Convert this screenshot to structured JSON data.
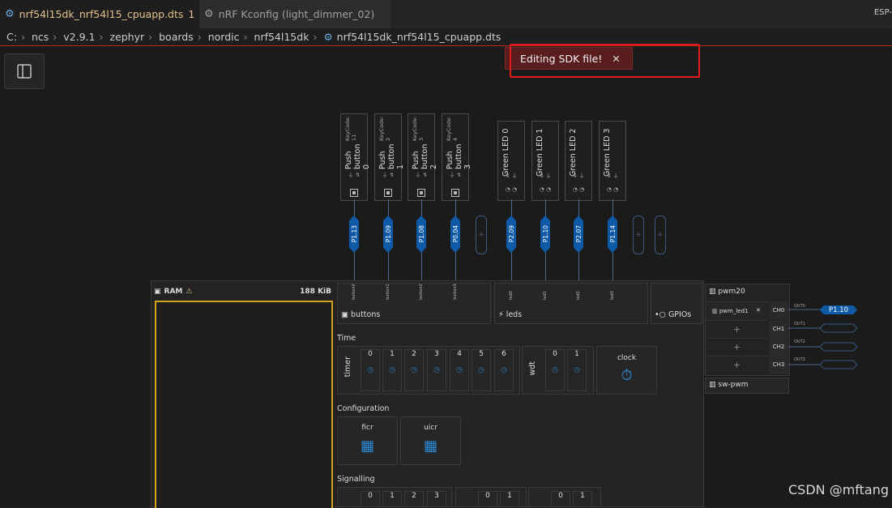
{
  "tabs": [
    {
      "label": "nrf54l15dk_nrf54l15_cpuapp.dts",
      "modified": "1",
      "icon": "devicetree-icon"
    },
    {
      "label": "nRF Kconfig (light_dimmer_02)",
      "icon": "gear-icon"
    }
  ],
  "top_right_label": "ESP-",
  "breadcrumbs": [
    "C:",
    "ncs",
    "v2.9.1",
    "zephyr",
    "boards",
    "nordic",
    "nrf54l15dk",
    "nrf54l15dk_nrf54l15_cpuapp.dts"
  ],
  "notification": {
    "text": "Editing SDK file!",
    "close": "✕"
  },
  "buttons": [
    {
      "name": "Push button 0",
      "keycode": "KeyCode: 11",
      "pin": "P1.13",
      "label": "button0"
    },
    {
      "name": "Push button 1",
      "keycode": "KeyCode: 2",
      "pin": "P1.09",
      "label": "button1"
    },
    {
      "name": "Push button 2",
      "keycode": "KeyCode: 3",
      "pin": "P1.08",
      "label": "button2"
    },
    {
      "name": "Push button 3",
      "keycode": "KeyCode: 4",
      "pin": "P0.04",
      "label": "button3"
    }
  ],
  "leds": [
    {
      "name": "Green LED 0",
      "pin": "P2.09",
      "label": "led0"
    },
    {
      "name": "Green LED 1",
      "pin": "P1.10",
      "label": "led1"
    },
    {
      "name": "Green LED 2",
      "pin": "P2.07",
      "label": "led2"
    },
    {
      "name": "Green LED 3",
      "pin": "P1.14",
      "label": "led3"
    }
  ],
  "ram": {
    "label": "RAM",
    "size": "188 KiB"
  },
  "groups": {
    "buttons": "buttons",
    "leds": "leds",
    "gpios": "GPIOs"
  },
  "time": {
    "section": "Time",
    "timer_label": "timer",
    "timers": [
      "0",
      "1",
      "2",
      "3",
      "4",
      "5",
      "6"
    ],
    "wdt_label": "wdt",
    "wdts": [
      "0",
      "1"
    ],
    "clock_label": "clock"
  },
  "configuration": {
    "section": "Configuration",
    "items": [
      "ficr",
      "uicr"
    ]
  },
  "signalling": {
    "section": "Signalling",
    "a": [
      "0",
      "1",
      "2",
      "3"
    ],
    "b": [
      "0",
      "1"
    ],
    "c": [
      "0",
      "1"
    ]
  },
  "pwm": {
    "title": "pwm20",
    "node": "pwm_led1",
    "channels": [
      "CH0",
      "CH1",
      "CH2",
      "CH3"
    ],
    "outputs": [
      "OUT0",
      "OUT1",
      "OUT2",
      "OUT3"
    ],
    "out0_pin": "P1.10",
    "sw_pwm": "sw-pwm"
  },
  "watermark": "CSDN @mftang"
}
